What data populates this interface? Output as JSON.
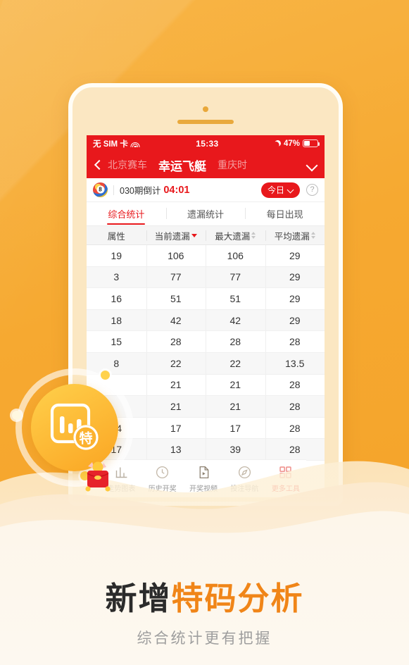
{
  "status_bar": {
    "carrier": "无 SIM 卡",
    "wifi_icon": "wifi-icon",
    "time": "15:33",
    "moon_icon": "moon-icon",
    "battery_percent": "47%",
    "battery_icon": "battery-icon"
  },
  "nav": {
    "back_icon": "chevron-left-icon",
    "items": [
      {
        "label": "北京赛车",
        "active": false
      },
      {
        "label": "幸运飞艇",
        "active": true
      },
      {
        "label": "重庆时",
        "active": false
      }
    ],
    "expand_icon": "chevron-down-icon"
  },
  "countdown": {
    "ball_icon": "lottery-ball-icon",
    "ball_number": "8",
    "label": "030期倒计",
    "time": "04:01",
    "today_button": "今日",
    "today_chevron_icon": "chevron-down-icon",
    "help_icon": "?"
  },
  "tabs": [
    {
      "label": "综合统计",
      "active": true
    },
    {
      "label": "遗漏统计",
      "active": false
    },
    {
      "label": "每日出现",
      "active": false
    }
  ],
  "table": {
    "headers": [
      {
        "label": "属性",
        "sortable": false,
        "sort": "none"
      },
      {
        "label": "当前遗漏",
        "sortable": true,
        "sort": "desc"
      },
      {
        "label": "最大遗漏",
        "sortable": true,
        "sort": "none"
      },
      {
        "label": "平均遗漏",
        "sortable": true,
        "sort": "none"
      }
    ],
    "rows": [
      [
        "19",
        "106",
        "106",
        "29"
      ],
      [
        "3",
        "77",
        "77",
        "29"
      ],
      [
        "16",
        "51",
        "51",
        "29"
      ],
      [
        "18",
        "42",
        "42",
        "29"
      ],
      [
        "15",
        "28",
        "28",
        "28"
      ],
      [
        "8",
        "22",
        "22",
        "13.5"
      ],
      [
        "",
        "21",
        "21",
        "28"
      ],
      [
        "",
        "21",
        "21",
        "28"
      ],
      [
        "14",
        "17",
        "17",
        "28"
      ],
      [
        "17",
        "13",
        "39",
        "28"
      ]
    ]
  },
  "tabbar": [
    {
      "label": "走势图表",
      "icon": "chart-icon",
      "active": false
    },
    {
      "label": "历史开奖",
      "icon": "clock-icon",
      "active": false
    },
    {
      "label": "开奖视频",
      "icon": "video-file-icon",
      "active": false
    },
    {
      "label": "投注导航",
      "icon": "compass-icon",
      "active": false
    },
    {
      "label": "更多工具",
      "icon": "grid-icon",
      "active": true
    }
  ],
  "badge": {
    "icon": "chart-bars-icon",
    "character": "特"
  },
  "sticker": {
    "icon": "red-envelope-icon"
  },
  "promo": {
    "headline_dark": "新增",
    "headline_accent": "特码分析",
    "subline": "综合统计更有把握"
  },
  "colors": {
    "background_orange": "#f6a931",
    "brand_red": "#e8181c",
    "accent_orange": "#f08518",
    "badge_yellow": "#fcb22f"
  }
}
